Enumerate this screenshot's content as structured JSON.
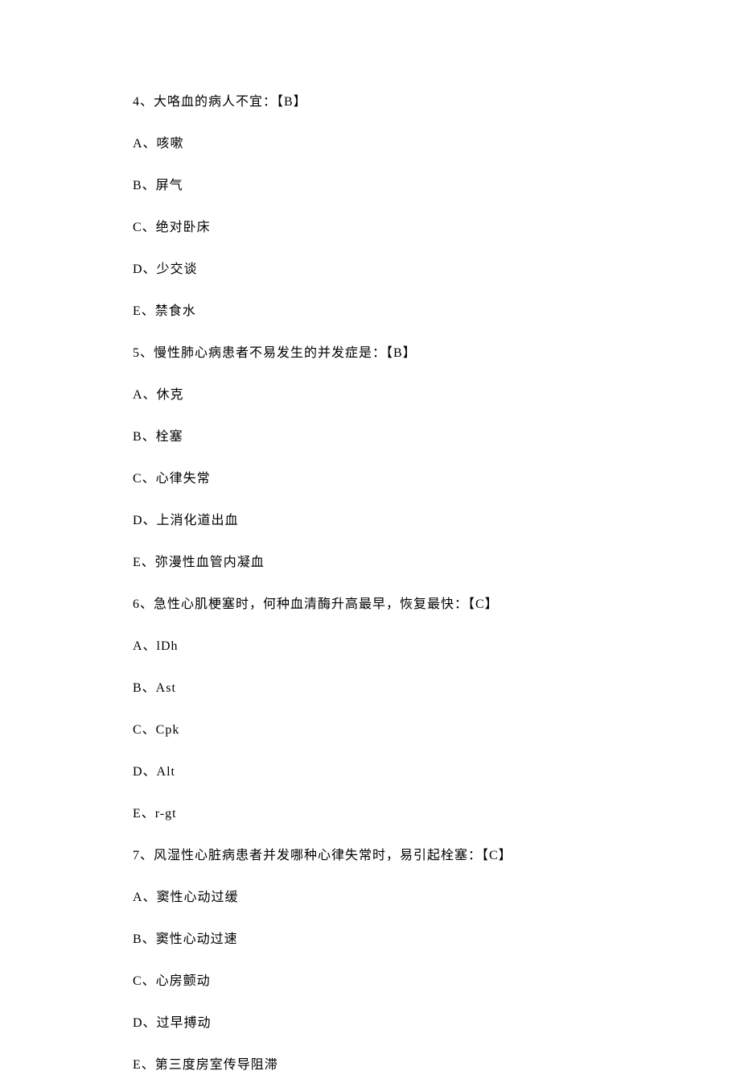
{
  "questions": [
    {
      "stem": "4、大咯血的病人不宜：【B】",
      "options": [
        "A、咳嗽",
        "B、屏气",
        "C、绝对卧床",
        "D、少交谈",
        "E、禁食水"
      ]
    },
    {
      "stem": "5、慢性肺心病患者不易发生的并发症是：【B】",
      "options": [
        "A、休克",
        "B、栓塞",
        "C、心律失常",
        "D、上消化道出血",
        "E、弥漫性血管内凝血"
      ]
    },
    {
      "stem": "6、急性心肌梗塞时，何种血清酶升高最早，恢复最快：【C】",
      "options": [
        "A、lDh",
        "B、Ast",
        "C、Cpk",
        "D、Alt",
        "E、r-gt"
      ]
    },
    {
      "stem": "7、风湿性心脏病患者并发哪种心律失常时，易引起栓塞：【C】",
      "options": [
        "A、窦性心动过缓",
        "B、窦性心动过速",
        "C、心房颤动",
        "D、过早搏动",
        "E、第三度房室传导阻滞"
      ]
    }
  ]
}
